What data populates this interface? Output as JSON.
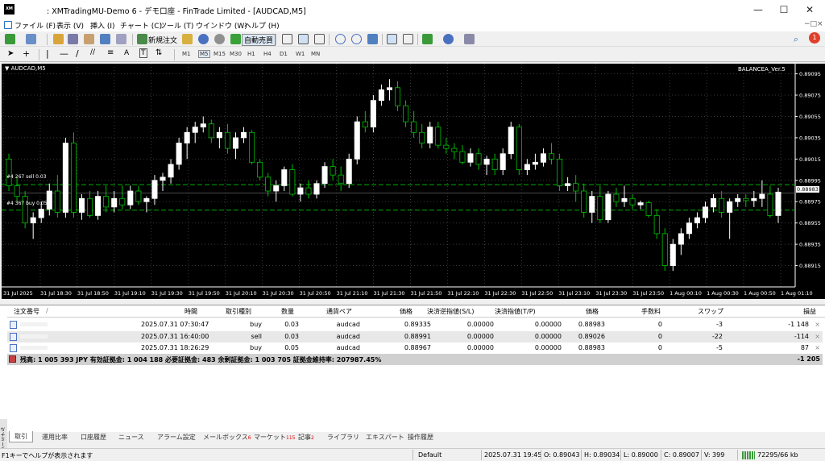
{
  "window": {
    "title": ": XMTradingMU-Demo 6 - デモ口座 - FinTrade Limited - [AUDCAD,M5]",
    "logo_text": "XM"
  },
  "menu": [
    "ファイル (F)",
    "表示 (V)",
    "挿入 (I)",
    "チャート (C)",
    "ツール (T)",
    "ウインドウ (W)",
    "ヘルプ (H)"
  ],
  "toolbar": {
    "new_order": "新規注文",
    "auto_trade": "自動売買",
    "notification_count": "1"
  },
  "timeframes": [
    "M1",
    "M5",
    "M15",
    "M30",
    "H1",
    "H4",
    "D1",
    "W1",
    "MN"
  ],
  "active_timeframe": "M5",
  "chart": {
    "symbol_label": "AUDCAD,M5",
    "ea_label": "BALANCEA_Ver.5",
    "current_price": "0.88983",
    "order_line_sell": "#4      267 sell 0.03",
    "order_line_buy": "#4      367 buy 0.05",
    "colors": {
      "background": "#000000",
      "bull": "#ffffff",
      "bear": "#00c000",
      "grid": "#3a3a3a",
      "order_line": "#00b000"
    }
  },
  "chart_data": {
    "type": "candlestick",
    "symbol": "AUDCAD",
    "timeframe": "M5",
    "y_ticks": [
      "0.89095",
      "0.89075",
      "0.89055",
      "0.89035",
      "0.89015",
      "0.88995",
      "0.88975",
      "0.88955",
      "0.88935",
      "0.88915"
    ],
    "ylim": [
      0.88895,
      0.89103
    ],
    "x_ticks": [
      "31 Jul 2025",
      "31 Jul 18:30",
      "31 Jul 18:50",
      "31 Jul 19:10",
      "31 Jul 19:30",
      "31 Jul 19:50",
      "31 Jul 20:10",
      "31 Jul 20:30",
      "31 Jul 20:50",
      "31 Jul 21:10",
      "31 Jul 21:30",
      "31 Jul 21:50",
      "31 Jul 22:10",
      "31 Jul 22:30",
      "31 Jul 22:50",
      "31 Jul 23:10",
      "31 Jul 23:30",
      "31 Jul 23:50",
      "1 Aug 00:10",
      "1 Aug 00:30",
      "1 Aug 00:50",
      "1 Aug 01:10"
    ],
    "grid": true,
    "order_levels": [
      0.88991,
      0.88967
    ],
    "candles": [
      [
        0.89015,
        0.8902,
        0.88985,
        0.8899
      ],
      [
        0.8899,
        0.88998,
        0.88975,
        0.8898
      ],
      [
        0.8898,
        0.88985,
        0.8895,
        0.88955
      ],
      [
        0.88955,
        0.88965,
        0.8894,
        0.8896
      ],
      [
        0.8896,
        0.88975,
        0.88955,
        0.88968
      ],
      [
        0.88968,
        0.88992,
        0.88962,
        0.88985
      ],
      [
        0.88985,
        0.89,
        0.8896,
        0.88965
      ],
      [
        0.88965,
        0.89035,
        0.8896,
        0.8903
      ],
      [
        0.8903,
        0.8904,
        0.8896,
        0.88965
      ],
      [
        0.88965,
        0.88982,
        0.88958,
        0.88978
      ],
      [
        0.88978,
        0.88985,
        0.8896,
        0.88962
      ],
      [
        0.88962,
        0.88985,
        0.88958,
        0.8898
      ],
      [
        0.8898,
        0.8899,
        0.88965,
        0.8897
      ],
      [
        0.8897,
        0.88985,
        0.88965,
        0.88978
      ],
      [
        0.88978,
        0.8899,
        0.88968,
        0.88972
      ],
      [
        0.88972,
        0.8899,
        0.88968,
        0.88985
      ],
      [
        0.88985,
        0.8899,
        0.88972,
        0.88975
      ],
      [
        0.88975,
        0.8898,
        0.88965,
        0.88978
      ],
      [
        0.88978,
        0.89,
        0.88972,
        0.88995
      ],
      [
        0.88995,
        0.89002,
        0.88985,
        0.88998
      ],
      [
        0.88998,
        0.89015,
        0.88992,
        0.8901
      ],
      [
        0.8901,
        0.89035,
        0.89005,
        0.8903
      ],
      [
        0.8903,
        0.89045,
        0.89015,
        0.8904
      ],
      [
        0.8904,
        0.8905,
        0.8903,
        0.89045
      ],
      [
        0.89045,
        0.89055,
        0.8904,
        0.89048
      ],
      [
        0.89048,
        0.89052,
        0.8903,
        0.89035
      ],
      [
        0.89035,
        0.89045,
        0.89025,
        0.8904
      ],
      [
        0.8904,
        0.89048,
        0.8902,
        0.89025
      ],
      [
        0.89025,
        0.8904,
        0.89015,
        0.89035
      ],
      [
        0.89035,
        0.89045,
        0.8903,
        0.8904
      ],
      [
        0.8904,
        0.89042,
        0.8901,
        0.89012
      ],
      [
        0.89012,
        0.89015,
        0.88995,
        0.88998
      ],
      [
        0.88998,
        0.89002,
        0.8898,
        0.88985
      ],
      [
        0.88985,
        0.88995,
        0.88975,
        0.8899
      ],
      [
        0.8899,
        0.89008,
        0.88985,
        0.89005
      ],
      [
        0.89005,
        0.8901,
        0.8898,
        0.88982
      ],
      [
        0.88982,
        0.88992,
        0.88975,
        0.88988
      ],
      [
        0.88988,
        0.88995,
        0.88978,
        0.88982
      ],
      [
        0.88982,
        0.88995,
        0.88978,
        0.88992
      ],
      [
        0.88992,
        0.89012,
        0.88988,
        0.89008
      ],
      [
        0.89008,
        0.89015,
        0.88995,
        0.89
      ],
      [
        0.89,
        0.89008,
        0.88985,
        0.88992
      ],
      [
        0.88992,
        0.8902,
        0.88988,
        0.89015
      ],
      [
        0.89015,
        0.89055,
        0.8901,
        0.8905
      ],
      [
        0.8905,
        0.8906,
        0.8904,
        0.89045
      ],
      [
        0.89045,
        0.89075,
        0.8904,
        0.8907
      ],
      [
        0.8907,
        0.89085,
        0.89065,
        0.8908
      ],
      [
        0.8908,
        0.8909,
        0.8907,
        0.89082
      ],
      [
        0.89082,
        0.89088,
        0.8906,
        0.89065
      ],
      [
        0.89065,
        0.8907,
        0.89045,
        0.8905
      ],
      [
        0.8905,
        0.8906,
        0.89035,
        0.8904
      ],
      [
        0.8904,
        0.89048,
        0.89025,
        0.8903
      ],
      [
        0.8903,
        0.8905,
        0.89025,
        0.89045
      ],
      [
        0.89045,
        0.8905,
        0.89025,
        0.89028
      ],
      [
        0.89028,
        0.89035,
        0.8902,
        0.89025
      ],
      [
        0.89025,
        0.8903,
        0.89015,
        0.89022
      ],
      [
        0.89022,
        0.89028,
        0.8901,
        0.89012
      ],
      [
        0.89012,
        0.89025,
        0.89008,
        0.8902
      ],
      [
        0.8902,
        0.89025,
        0.89005,
        0.8901
      ],
      [
        0.8901,
        0.89018,
        0.89,
        0.89015
      ],
      [
        0.89015,
        0.8902,
        0.89,
        0.89005
      ],
      [
        0.89005,
        0.89025,
        0.89,
        0.8902
      ],
      [
        0.8902,
        0.8905,
        0.89015,
        0.89045
      ],
      [
        0.89045,
        0.89048,
        0.89,
        0.89005
      ],
      [
        0.89005,
        0.89015,
        0.89,
        0.8901
      ],
      [
        0.8901,
        0.8902,
        0.89005,
        0.89012
      ],
      [
        0.89012,
        0.89025,
        0.89008,
        0.8902
      ],
      [
        0.8902,
        0.8903,
        0.8901,
        0.89015
      ],
      [
        0.89015,
        0.8902,
        0.88985,
        0.8899
      ],
      [
        0.8899,
        0.88998,
        0.88985,
        0.88992
      ],
      [
        0.88992,
        0.89,
        0.88975,
        0.88985
      ],
      [
        0.88985,
        0.88992,
        0.8896,
        0.88965
      ],
      [
        0.88965,
        0.88985,
        0.88955,
        0.8898
      ],
      [
        0.8898,
        0.8899,
        0.88955,
        0.88958
      ],
      [
        0.88958,
        0.88985,
        0.88955,
        0.88982
      ],
      [
        0.88982,
        0.88988,
        0.8897,
        0.88975
      ],
      [
        0.88975,
        0.8899,
        0.8897,
        0.88978
      ],
      [
        0.88978,
        0.88982,
        0.88968,
        0.88972
      ],
      [
        0.88972,
        0.88976,
        0.88968,
        0.88974
      ],
      [
        0.88974,
        0.88976,
        0.8896,
        0.88962
      ],
      [
        0.88962,
        0.88968,
        0.8894,
        0.88945
      ],
      [
        0.88945,
        0.8895,
        0.8891,
        0.88915
      ],
      [
        0.88915,
        0.8894,
        0.8891,
        0.88935
      ],
      [
        0.88935,
        0.8895,
        0.88925,
        0.88945
      ],
      [
        0.88945,
        0.8896,
        0.8894,
        0.88955
      ],
      [
        0.88955,
        0.88965,
        0.8895,
        0.8896
      ],
      [
        0.8896,
        0.88975,
        0.88955,
        0.8897
      ],
      [
        0.8897,
        0.88982,
        0.88965,
        0.88978
      ],
      [
        0.88978,
        0.88985,
        0.8896,
        0.88965
      ],
      [
        0.88965,
        0.88978,
        0.8894,
        0.88975
      ],
      [
        0.88975,
        0.88982,
        0.8897,
        0.88978
      ],
      [
        0.88978,
        0.88982,
        0.8897,
        0.88976
      ],
      [
        0.88976,
        0.88985,
        0.8897,
        0.88978
      ],
      [
        0.88978,
        0.88995,
        0.8897,
        0.88982
      ],
      [
        0.88982,
        0.8899,
        0.8896,
        0.88962
      ],
      [
        0.88962,
        0.88988,
        0.88955,
        0.88984
      ]
    ]
  },
  "terminal": {
    "headers": [
      "注文番号",
      "/",
      "時間",
      "取引種別",
      "数量",
      "通貨ペア",
      "価格",
      "決済逆指値(S/L)",
      "決済指値(T/P)",
      "価格",
      "手数料",
      "スワップ",
      "損益"
    ],
    "orders": [
      {
        "time": "2025.07.31 07:30:47",
        "type": "buy",
        "volume": "0.03",
        "symbol": "audcad",
        "price": "0.89335",
        "sl": "0.00000",
        "tp": "0.00000",
        "current": "0.88983",
        "commission": "0",
        "swap": "-3",
        "profit": "-1 148"
      },
      {
        "time": "2025.07.31 16:40:00",
        "type": "sell",
        "volume": "0.03",
        "symbol": "audcad",
        "price": "0.88991",
        "sl": "0.00000",
        "tp": "0.00000",
        "current": "0.89026",
        "commission": "0",
        "swap": "-22",
        "profit": "-114"
      },
      {
        "time": "2025.07.31 18:26:29",
        "type": "buy",
        "volume": "0.05",
        "symbol": "audcad",
        "price": "0.88967",
        "sl": "0.00000",
        "tp": "0.00000",
        "current": "0.88983",
        "commission": "0",
        "swap": "-5",
        "profit": "87"
      }
    ],
    "summary": "残高: 1 005 393 JPY  有効証拠金: 1 004 188  必要証拠金: 483  余剰証拠金: 1 003 705  証拠金維持率: 207987.45%",
    "summary_total": "-1 205",
    "side_label": "ターミナル"
  },
  "tabs": [
    {
      "label": "取引",
      "badge": ""
    },
    {
      "label": "運用比率",
      "badge": ""
    },
    {
      "label": "口座履歴",
      "badge": ""
    },
    {
      "label": "ニュース",
      "badge": ""
    },
    {
      "label": "アラーム設定",
      "badge": ""
    },
    {
      "label": "メールボックス",
      "badge": "6"
    },
    {
      "label": "マーケット",
      "badge": "115"
    },
    {
      "label": "記事",
      "badge": "2"
    },
    {
      "label": "ライブラリ",
      "badge": ""
    },
    {
      "label": "エキスパート",
      "badge": ""
    },
    {
      "label": "操作履歴",
      "badge": ""
    }
  ],
  "status": {
    "help": "F1キーでヘルプが表示されます",
    "profile": "Default",
    "datetime": "2025.07.31 19:45",
    "open": "O: 0.89043",
    "high": "H: 0.89034",
    "low": "L: 0.89000",
    "close": "C: 0.89007",
    "volume": "V: 399",
    "traffic": "72295/66 kb"
  }
}
